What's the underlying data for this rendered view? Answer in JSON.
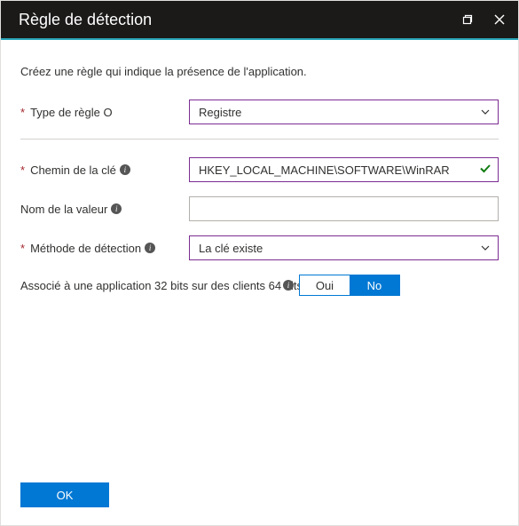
{
  "header": {
    "title": "Règle de détection"
  },
  "intro": "Créez une règle qui indique la présence de l'application.",
  "fields": {
    "rule_type_label": "Type de règle",
    "rule_type_value": "Registre",
    "key_path_label": "Chemin de la clé",
    "key_path_value": "HKEY_LOCAL_MACHINE\\SOFTWARE\\WinRAR",
    "value_name_label": "Nom de la valeur",
    "value_name_value": "",
    "detect_method_label": "Méthode de détection",
    "detect_method_value": "La clé existe"
  },
  "assoc": {
    "label": "Associé à une application 32 bits sur des clients 64 bits",
    "yes": "Oui",
    "no": "No",
    "selected": "no"
  },
  "footer": {
    "ok": "OK"
  }
}
